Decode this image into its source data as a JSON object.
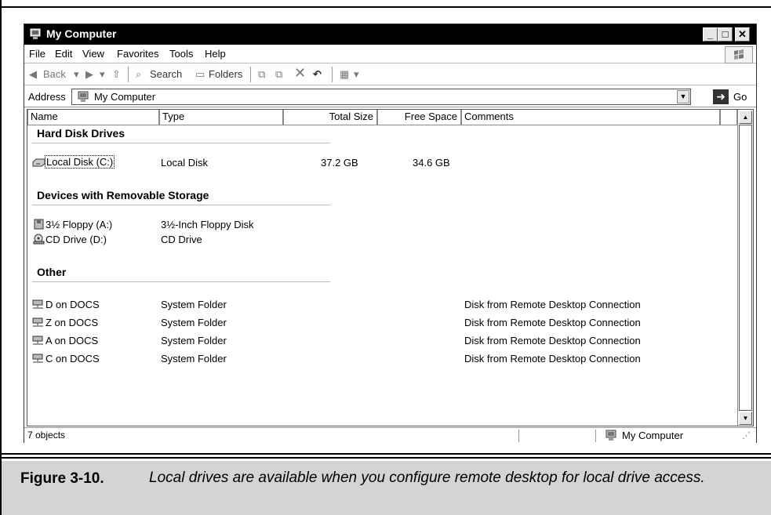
{
  "window": {
    "title": "My Computer",
    "minimize": "_",
    "maximize": "□",
    "close": "✕"
  },
  "menu": [
    "File",
    "Edit",
    "View",
    "Favorites",
    "Tools",
    "Help"
  ],
  "toolbar": {
    "back": "Back",
    "search": "Search",
    "folders": "Folders"
  },
  "address": {
    "label": "Address",
    "value": "My Computer",
    "go": "Go"
  },
  "columns": [
    "Name",
    "Type",
    "Total Size",
    "Free Space",
    "Comments"
  ],
  "groups": {
    "hard_disks": {
      "title": "Hard Disk Drives",
      "items": [
        {
          "name": "Local Disk (C:)",
          "type": "Local Disk",
          "total": "37.2 GB",
          "free": "34.6 GB",
          "comment": ""
        }
      ]
    },
    "removable": {
      "title": "Devices with Removable Storage",
      "items": [
        {
          "name": "3½ Floppy (A:)",
          "type": "3½-Inch Floppy Disk"
        },
        {
          "name": "CD Drive (D:)",
          "type": "CD Drive"
        }
      ]
    },
    "other": {
      "title": "Other",
      "items": [
        {
          "name": "D on DOCS",
          "type": "System Folder",
          "comment": "Disk from Remote Desktop Connection"
        },
        {
          "name": "Z on DOCS",
          "type": "System Folder",
          "comment": "Disk from Remote Desktop Connection"
        },
        {
          "name": "A on DOCS",
          "type": "System Folder",
          "comment": "Disk from Remote Desktop Connection"
        },
        {
          "name": "C on DOCS",
          "type": "System Folder",
          "comment": "Disk from Remote Desktop Connection"
        }
      ]
    }
  },
  "status": {
    "count": "7 objects",
    "location": "My Computer"
  },
  "caption": {
    "label": "Figure 3-10.",
    "text": "Local drives are available when you configure remote desktop for local drive access."
  }
}
